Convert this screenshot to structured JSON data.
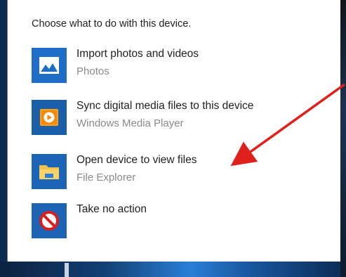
{
  "dialog": {
    "prompt": "Choose what to do with this device."
  },
  "options": [
    {
      "icon": "photos-icon",
      "title": "Import photos and videos",
      "subtitle": "Photos"
    },
    {
      "icon": "windows-media-player-icon",
      "title": "Sync digital media files to this device",
      "subtitle": "Windows Media Player"
    },
    {
      "icon": "folder-icon",
      "title": "Open device to view files",
      "subtitle": "File Explorer"
    },
    {
      "icon": "no-action-icon",
      "title": "Take no action",
      "subtitle": ""
    }
  ],
  "colors": {
    "tile_blue": "#1e6ec8",
    "annotation_red": "#e0201c",
    "subtitle_gray": "#8a8a8a"
  }
}
